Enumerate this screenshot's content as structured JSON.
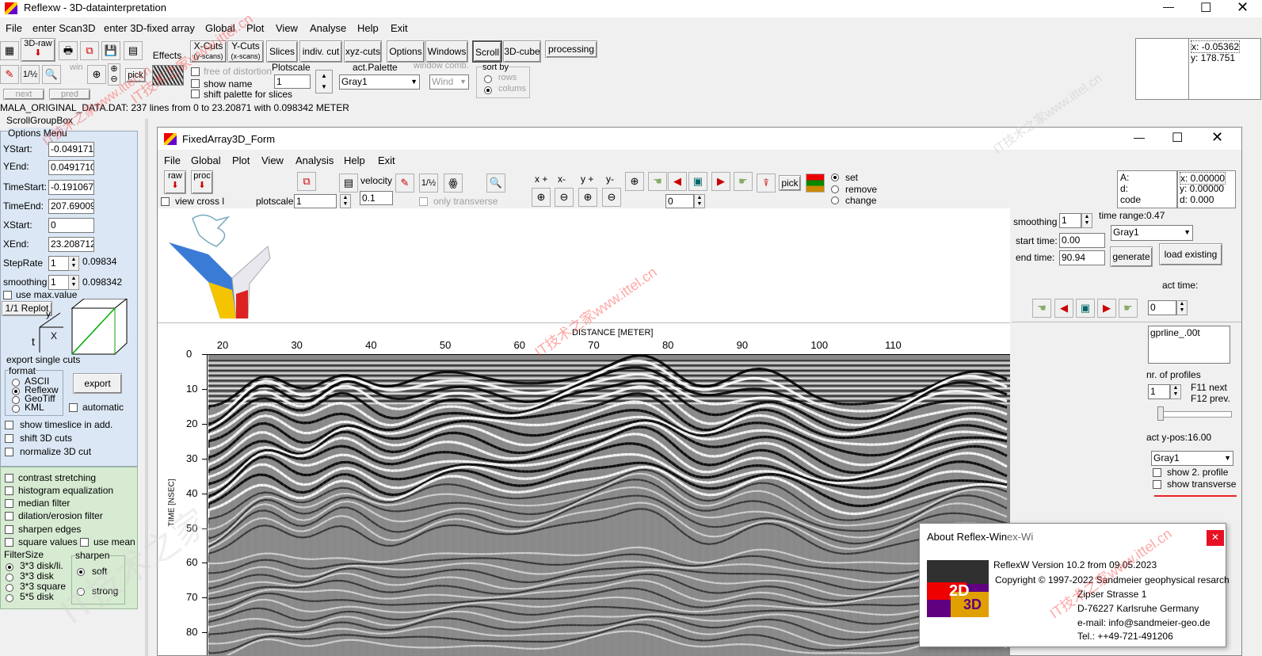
{
  "app": {
    "title": "Reflexw - 3D-datainterpretation"
  },
  "main_menu": [
    "File",
    "enter Scan3D",
    "enter 3D-fixed array",
    "Global",
    "Plot",
    "View",
    "Analyse",
    "Help",
    "Exit"
  ],
  "toolbar": {
    "raw3d": "3D-raw",
    "effects": "Effects",
    "xcuts": "X-Cuts",
    "xcuts_sub": "(y-scans)",
    "ycuts": "Y-Cuts",
    "ycuts_sub": "(x-scans)",
    "slices": "Slices",
    "indiv_cut": "indiv. cut",
    "xyz_cuts": "xyz-cuts",
    "options": "Options",
    "windows": "Windows",
    "scroll": "Scroll",
    "cube3d": "3D-cube",
    "processing": "processing",
    "win": "win",
    "pick": "pick",
    "free_distortion": "free of distortion",
    "show_name": "show name",
    "shift_palette": "shift palette for slices",
    "plotscale_label": "Plotscale",
    "plotscale_value": "1",
    "act_palette_label": "act.Palette",
    "act_palette_value": "Gray1",
    "window_comb_label": "window comb.",
    "window_comb_value": "Wind",
    "sort_by_label": "sort by",
    "sort_rows": "rows",
    "sort_columns": "colums",
    "next": "next",
    "pred": "pred",
    "coord_x": "x: -0.05362",
    "coord_y": "y: 178.751"
  },
  "status_line": "MALA_ORIGINAL_DATA.DAT: 237 lines from 0 to 23.20871 with 0.098342 METER",
  "left_panel": {
    "scroll_group": "ScrollGroupBox",
    "options_menu": "Options Menu",
    "ystart_label": "YStart:",
    "ystart": "-0.049171",
    "yend_label": "YEnd:",
    "yend": "0.0491710",
    "timestart_label": "TimeStart:",
    "timestart": "-0.191067",
    "timeend_label": "TimeEnd:",
    "timeend": "207.69009",
    "xstart_label": "XStart:",
    "xstart": "0",
    "xend_label": "XEnd:",
    "xend": "23.208712",
    "steprate_label": "StepRate",
    "steprate": "1",
    "steprate_val": "0.09834",
    "smoothing_label": "smoothing",
    "smoothing": "1",
    "smoothing_val": "0.098342",
    "use_max": "use max.value",
    "replot": "1/1 Replot",
    "cube_x": "X",
    "cube_y": "y",
    "cube_t": "t",
    "export_single": "export single cuts",
    "format": "format",
    "fmt_ascii": "ASCII",
    "fmt_reflexw": "Reflexw",
    "fmt_geotiff": "GeoTiff",
    "fmt_kml": "KML",
    "export": "export",
    "automatic": "automatic",
    "show_timeslice": "show timeslice in add.",
    "shift_3d": "shift 3D cuts",
    "normalize_3d": "normalize 3D cut",
    "contrast": "contrast stretching",
    "histogram": "histogram equalization",
    "median": "median filter",
    "dilation": "dilation/erosion filter",
    "sharpen_edges": "sharpen edges",
    "square_values": "square values",
    "use_mean": "use mean",
    "filtersize": "FilterSize",
    "fs1": "3*3 disk/li.",
    "fs2": "3*3 disk",
    "fs3": "3*3 square",
    "fs4": "5*5 disk",
    "sharpen": "sharpen",
    "soft": "soft",
    "strong": "strong"
  },
  "inner_window": {
    "title": "FixedArray3D_Form",
    "menu": [
      "File",
      "Global",
      "Plot",
      "View",
      "Analysis",
      "Help",
      "Exit"
    ],
    "raw": "raw",
    "proc": "proc",
    "velocity": "velocity",
    "velocity_value": "0.1",
    "view_cross": "view cross l",
    "plotscale_label": "plotscale",
    "plotscale_value": "1",
    "only_transverse": "only transverse",
    "xplus": "x +",
    "xminus": "x-",
    "yplus": "y +",
    "yminus": "y-",
    "zoom_value": "0",
    "pick": "pick",
    "set": "set",
    "remove": "remove",
    "change": "change",
    "info_a": "A:",
    "info_d": "d:",
    "info_code": "code",
    "info_x": "x: 0.00000",
    "info_y": "y: 0.00000",
    "info_dd": "d: 0.000"
  },
  "right_panel": {
    "smoothing_label": "smoothing",
    "smoothing": "1",
    "time_range": "time range:0.47",
    "start_time_label": "start time:",
    "start_time": "0.00",
    "end_time_label": "end time:",
    "end_time": "90.94",
    "palette": "Gray1",
    "generate": "generate",
    "load_existing": "load existing",
    "act_time_label": "act time:",
    "act_time": "0",
    "profile_file": "gprline_.00t",
    "nr_profiles_label": "nr. of profiles",
    "nr_profiles": "1",
    "f11": "F11 next",
    "f12": "F12 prev.",
    "act_ypos": "act y-pos:16.00",
    "palette2": "Gray1",
    "show2": "show 2. profile",
    "show_transverse": "show transverse"
  },
  "chart_data": {
    "type": "heatmap",
    "xlabel": "DISTANCE [METER]",
    "ylabel": "TIME [NSEC]",
    "x_ticks": [
      "20",
      "30",
      "40",
      "50",
      "60",
      "70",
      "80",
      "90",
      "100",
      "110"
    ],
    "y_ticks": [
      "0",
      "10",
      "20",
      "30",
      "40",
      "50",
      "60",
      "70",
      "80"
    ],
    "xlim": [
      18,
      126
    ],
    "ylim": [
      0,
      87
    ]
  },
  "about_dialog": {
    "title": "About Reflex-Win",
    "title_ghost": "ex-Wi",
    "version": "ReflexW Version 10.2 from 09.05.2023",
    "copyright": "Copyright © 1997-2022 Sandmeier geophysical resarch",
    "street": "Zipser Strasse 1",
    "city": "D-76227 Karlsruhe  Germany",
    "email": "e-mail: info@sandmeier-geo.de",
    "tel": "Tel.: ++49-721-491206",
    "logo_2d": "2D",
    "logo_3d": "3D"
  },
  "watermarks": [
    "IT技术之家www.ittel.cn",
    "IT技术之家www.ittel.cn",
    "IT技术之家www.ittel.cn",
    "IT技术之家www.ittel.cn",
    "IT技术之家www.ittel.cn",
    "IT技术之家"
  ]
}
